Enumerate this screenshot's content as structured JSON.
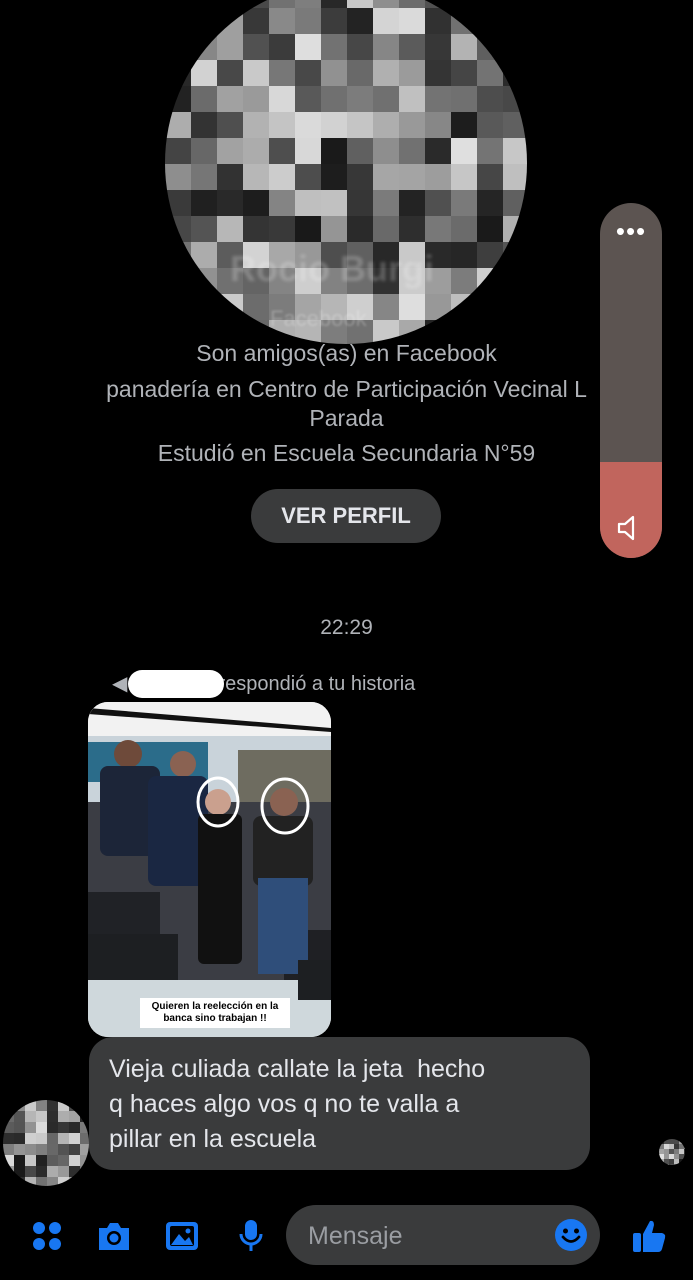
{
  "profile": {
    "name": "Rocio Burgi",
    "subtitle": "Facebook",
    "friends_text": "Son amigos(as) en Facebook",
    "work_line1": "panadería en Centro de Participación Vecinal L",
    "work_line2": "Parada",
    "school_text": "Estudió en Escuela Secundaria N°59",
    "view_profile_label": "VER PERFIL"
  },
  "volume": {
    "more_label": "•••",
    "level": 0.27,
    "icon": "speaker-icon",
    "track_color": "#5c5451",
    "fill_color": "#c1655d"
  },
  "conversation": {
    "timestamp": "22:29",
    "story_reply_label": "respondió a tu historia",
    "story_caption": "Quieren la reelección en la banca sino trabajan !!",
    "message": "Vieja culiada callate la jeta  hecho\nq haces algo vos q no te valla a\npillar en la escuela"
  },
  "composer": {
    "placeholder": "Mensaje",
    "icons": [
      "menu-grid-icon",
      "camera-icon",
      "gallery-icon",
      "microphone-icon",
      "emoji-icon",
      "thumbs-up-icon"
    ],
    "accent": "#1877f2"
  },
  "colors": {
    "background": "#000000",
    "bubble": "#3a3b3c",
    "muted_text": "#b0b3b8"
  }
}
